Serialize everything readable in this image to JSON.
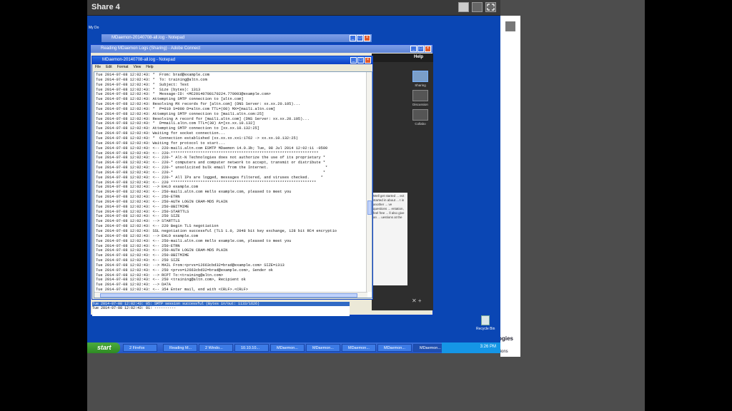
{
  "share": {
    "title": "Share 4"
  },
  "windows": {
    "back_notepad_title": "MDaemon-20140708-all.log - Notepad",
    "connect_title": "Reading MDaemon Logs (Sharing) - Adobe Connect",
    "notepad_title": "MDaemon-20140708-all.log - Notepad"
  },
  "menu": [
    "File",
    "Edit",
    "Format",
    "View",
    "Help"
  ],
  "log_lines": [
    "Tue 2014-07-08 12:02:43: *  From: brad@example.com",
    "Tue 2014-07-08 12:02:43: *  To: training@altn.com",
    "Tue 2014-07-08 12:02:43: *  Subject: Test",
    "Tue 2014-07-08 12:02:43: *  Size (bytes): 1313",
    "Tue 2014-07-08 12:02:43: *  Message-ID: <MC20140708170224.770003@example.com>",
    "Tue 2014-07-08 12:02:43: Attempting SMTP connection to [altn.com]",
    "Tue 2014-07-08 12:02:43: Resolving MX records for [altn.com] (DNS Server: xx.xx.20.105)...",
    "Tue 2014-07-08 12:02:43: *  P=010 S=000 D=altn.com TTL=(60) MX=[mail1.altn.com]",
    "Tue 2014-07-08 12:02:43: Attempting SMTP connection to [mail1.altn.com:25]",
    "Tue 2014-07-08 12:02:43: Resolving A record for [mail1.altn.com] (DNS Server: xx.xx.20.105)...",
    "Tue 2014-07-08 12:02:43: *  D=mail1.altn.com TTL=(30) A=[xx.xx.10.132]",
    "Tue 2014-07-08 12:02:43: Attempting SMTP connection to [xx.xx.10.132:25]",
    "Tue 2014-07-08 12:02:43: Waiting for socket connection...",
    "Tue 2014-07-08 12:02:43: *  Connection established (xx.xx.xx.xx1:1762 -> xx.xx.10.132:25)",
    "Tue 2014-07-08 12:02:43: Waiting for protocol to start...",
    "Tue 2014-07-08 12:02:43: <-- 220-mail1.altn.com ESMTP MDaemon 14.0.3b; Tue, 08 Jul 2014 12:02:11 -0500",
    "Tue 2014-07-08 12:02:43: <-- 220-*****************************************************************",
    "Tue 2014-07-08 12:02:43: <-- 220-* Alt-N Technologies does not authorize the use of its proprietary *",
    "Tue 2014-07-08 12:02:43: <-- 220-* computers and computer network to accept, transmit or distribute *",
    "Tue 2014-07-08 12:02:43: <-- 220-* unsolicited bulk email from the Internet.                         *",
    "Tue 2014-07-08 12:02:43: <-- 220-*                                                                  *",
    "Tue 2014-07-08 12:02:43: <-- 220-* All IPs are logged, messages filtered, and viruses checked.     *",
    "Tue 2014-07-08 12:02:43: <-- 220 ****************************************************************",
    "Tue 2014-07-08 12:02:43: --> EHLO example.com",
    "Tue 2014-07-08 12:02:43: <-- 250-mail1.altn.com Hello example.com, pleased to meet you",
    "Tue 2014-07-08 12:02:43: <-- 250-ETRN",
    "Tue 2014-07-08 12:02:43: <-- 250-AUTH LOGIN CRAM-MD5 PLAIN",
    "Tue 2014-07-08 12:02:43: <-- 250-8BITMIME",
    "Tue 2014-07-08 12:02:43: <-- 250-STARTTLS",
    "Tue 2014-07-08 12:02:43: <-- 250 SIZE",
    "Tue 2014-07-08 12:02:43: --> STARTTLS",
    "Tue 2014-07-08 12:02:43: <-- 220 Begin TLS negotiation",
    "Tue 2014-07-08 12:02:43: SSL negotiation successful (TLS 1.0, 2048 bit key exchange, 128 bit RC4 encryptio",
    "Tue 2014-07-08 12:02:43: --> EHLO example.com",
    "Tue 2014-07-08 12:02:43: <-- 250-mail1.altn.com Hello example.com, pleased to meet you",
    "Tue 2014-07-08 12:02:43: <-- 250-ETRN",
    "Tue 2014-07-08 12:02:43: <-- 250-AUTH LOGIN CRAM-MD5 PLAIN",
    "Tue 2014-07-08 12:02:43: <-- 250-8BITMIME",
    "Tue 2014-07-08 12:02:43: <-- 250 SIZE",
    "Tue 2014-07-08 12:02:43: --> MAIL From:<prvs=12663cbd32=brad@example.com> SIZE=1313",
    "Tue 2014-07-08 12:02:43: <-- 250 <prvs=12663cbd32=brad@example.com>, Sender ok",
    "Tue 2014-07-08 12:02:43: --> RCPT To:<training@altn.com>",
    "Tue 2014-07-08 12:02:43: <-- 250 <training@altn.com>, Recipient ok",
    "Tue 2014-07-08 12:02:43: --> DATA",
    "Tue 2014-07-08 12:02:43: <-- 354 Enter mail, end with <CRLF>.<CRLF>",
    "Tue 2014-07-08 12:02:43: Sending <c:\\mdaemon\\queues\\remote\\pd35000000244.msg> to [xx.xx.10.132]",
    "Tue 2014-07-08 12:02:43: Transfer Complete",
    "Tue 2014-07-08 12:02:43: <-- 250 Ok, message saved <Message-ID: <MC20140708170224.770003@example.com>>",
    "Tue 2014-07-08 12:02:43: --> QUIT",
    "Tue 2014-07-08 12:02:43: <-- 221 See ya in cyberspace",
    "Tue 2014-07-08 12:02:43: SMTP session successful (Bytes in/out: 1133/1626)",
    "Tue 2014-07-08 12:02:43: ----------"
  ],
  "back_lines": [
    "Tue 2014-07-08 12:02:43: 05: SMTP session successful (Bytes in/out: 1133/1626)",
    "Tue 2014-07-08 12:02:43: 01: ----------"
  ],
  "connect": {
    "help": "Help",
    "pods": [
      "Sharing",
      "Discussion",
      "Collabo"
    ],
    "message": "Well get started ... ect started in about ... t in another ... ve questions ... entation, feel free ... ll also give an ... uestions at the"
  },
  "desktop": {
    "my_docs": "My Do",
    "recycle_bin": "Recycle Bin"
  },
  "taskbar": {
    "start": "start",
    "items": [
      "2 Firefox",
      "Reading M...",
      "2 Windo...",
      "10.10.10...",
      "MDaemon...",
      "MDaemon...",
      "MDaemon...",
      "MDaemon...",
      "MDaemon..."
    ],
    "time": "3:26 PM"
  },
  "side_logo": {
    "line1": "ologies",
    "line2": "olutions"
  }
}
